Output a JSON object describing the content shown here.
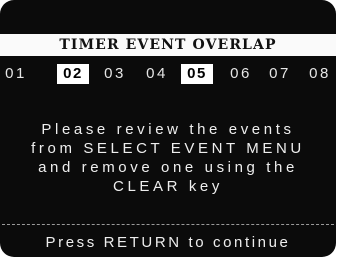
{
  "screen": {
    "title": "TIMER EVENT OVERLAP",
    "events": [
      {
        "label": "01",
        "selected": false
      },
      {
        "label": "02",
        "selected": true
      },
      {
        "label": "03",
        "selected": false
      },
      {
        "label": "04",
        "selected": false
      },
      {
        "label": "05",
        "selected": true
      },
      {
        "label": "06",
        "selected": false
      },
      {
        "label": "07",
        "selected": false
      },
      {
        "label": "08",
        "selected": false
      }
    ],
    "message_lines": [
      "Please review the events",
      "from SELECT EVENT MENU",
      "and remove one using the",
      "CLEAR key"
    ],
    "divider": "-----------------------------------",
    "footer": "Press RETURN to continue"
  }
}
